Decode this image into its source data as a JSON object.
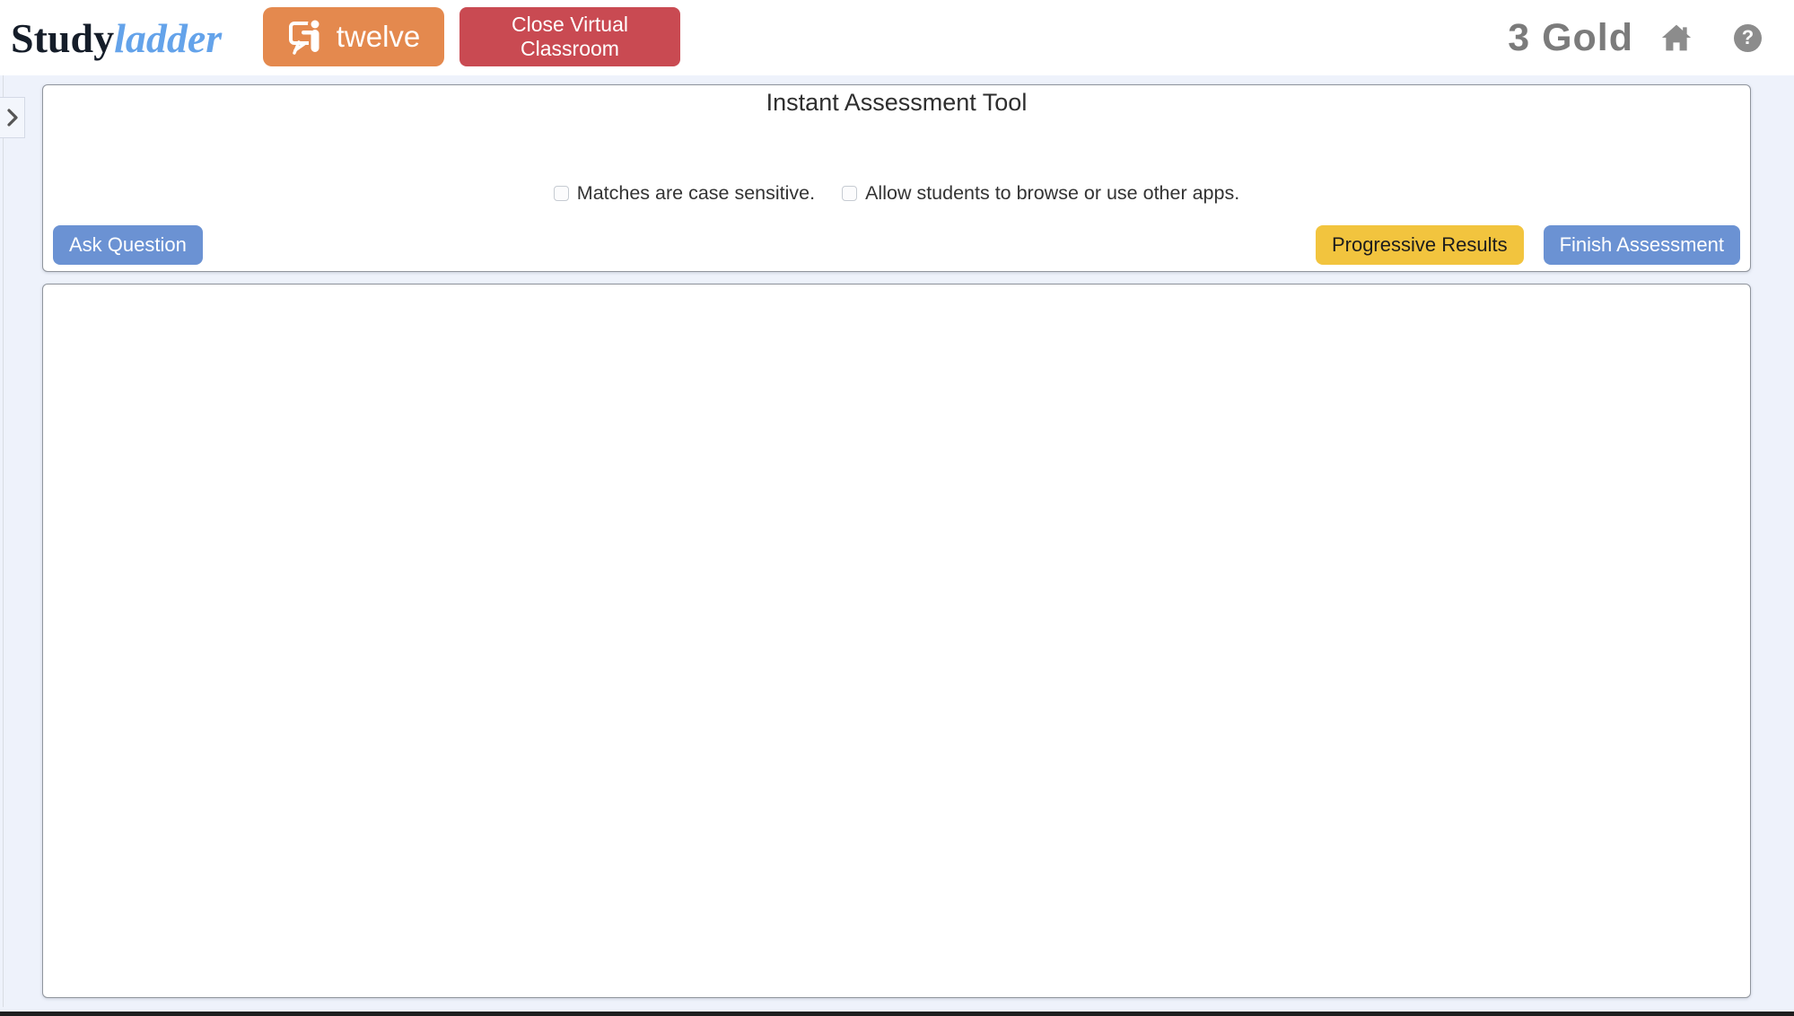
{
  "header": {
    "logo": {
      "part1": "Study",
      "part2": "ladder"
    },
    "classroom_button": {
      "label": "twelve",
      "icon": "presenter-board-icon"
    },
    "close_button": {
      "label": "Close Virtual Classroom"
    },
    "class_name": "3 Gold",
    "home_icon": "home-icon",
    "help_icon_glyph": "?"
  },
  "sidebar": {
    "expand_icon_glyph": "›"
  },
  "assessment_panel": {
    "title": "Instant Assessment Tool",
    "checkboxes": [
      {
        "label": "Matches are case sensitive.",
        "checked": false
      },
      {
        "label": "Allow students to browse or use other apps.",
        "checked": false
      }
    ],
    "buttons": {
      "ask_question": "Ask Question",
      "progressive_results": "Progressive Results",
      "finish_assessment": "Finish Assessment"
    }
  },
  "results_panel": {
    "content": ""
  },
  "colors": {
    "background": "#EEF2FB",
    "header_background": "#FFFFFF",
    "orange_button": "#E4894E",
    "red_button": "#C94A52",
    "blue_button": "#6B92D3",
    "yellow_button": "#F2C43E",
    "panel_border": "#90959D",
    "gray_text": "#7B7B7B",
    "logo_blue": "#64A3EA"
  }
}
